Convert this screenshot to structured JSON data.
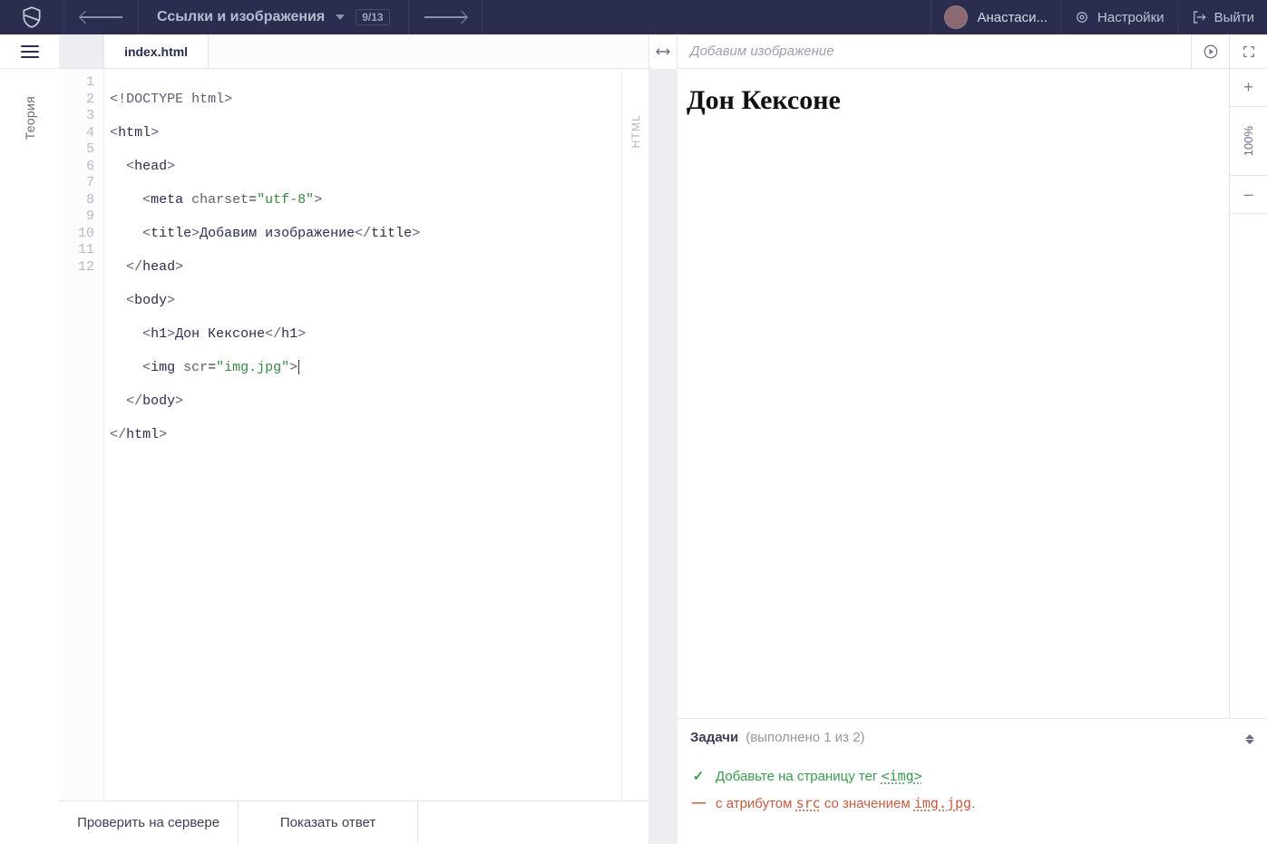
{
  "header": {
    "lesson_title": "Ссылки и изображения",
    "counter": "9/13",
    "user_name": "Анастаси...",
    "settings_label": "Настройки",
    "exit_label": "Выйти"
  },
  "sidebar": {
    "theory_label": "Теория"
  },
  "editor": {
    "tab_label": "index.html",
    "lang_badge": "HTML",
    "line_numbers": [
      "1",
      "2",
      "3",
      "4",
      "5",
      "6",
      "7",
      "8",
      "9",
      "10",
      "11",
      "12"
    ],
    "code": {
      "l1": {
        "a": "<!DOCTYPE html>"
      },
      "l2": {
        "open": "<",
        "tag": "html",
        "close": ">"
      },
      "l3": {
        "open": "<",
        "tag": "head",
        "close": ">"
      },
      "l4": {
        "open": "<",
        "tag": "meta",
        "sp": " ",
        "attr": "charset",
        "eq": "=",
        "val": "\"utf-8\"",
        "close": ">"
      },
      "l5": {
        "open": "<",
        "tag": "title",
        "close": ">",
        "text": "Добавим изображение",
        "open2": "</",
        "tag2": "title",
        "close2": ">"
      },
      "l6": {
        "open": "</",
        "tag": "head",
        "close": ">"
      },
      "l7": {
        "open": "<",
        "tag": "body",
        "close": ">"
      },
      "l8": {
        "open": "<",
        "tag": "h1",
        "close": ">",
        "text": "Дон Кексоне",
        "open2": "</",
        "tag2": "h1",
        "close2": ">"
      },
      "l9": {
        "open": "<",
        "tag": "img",
        "sp": " ",
        "attr": "scr",
        "eq": "=",
        "val": "\"img.jpg\"",
        "close": ">"
      },
      "l10": {
        "open": "</",
        "tag": "body",
        "close": ">"
      },
      "l11": {
        "open": "</",
        "tag": "html",
        "close": ">"
      }
    },
    "footer": {
      "check_label": "Проверить на сервере",
      "answer_label": "Показать ответ"
    }
  },
  "preview": {
    "title": "Добавим изображение",
    "h1": "Дон Кексоне",
    "zoom": "100%",
    "zoom_plus": "+",
    "zoom_minus": "–"
  },
  "tasks": {
    "label": "Задачи",
    "progress": "(выполнено 1 из 2)",
    "ok_mark": "✓",
    "bad_mark": "—",
    "t1_a": "Добавьте на страницу тег ",
    "t1_b": "<img>",
    "t2_a": "с атрибутом ",
    "t2_b": "src",
    "t2_c": " со значением ",
    "t2_d": "img.jpg",
    "t2_e": "."
  }
}
